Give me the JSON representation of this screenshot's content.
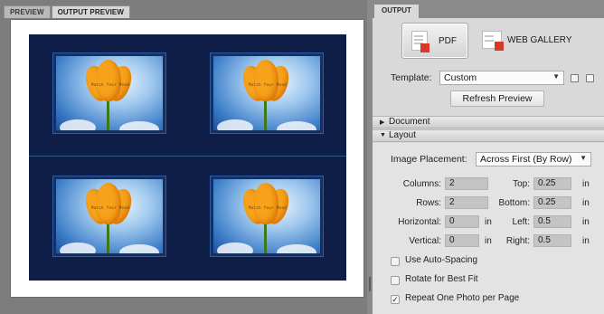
{
  "preview_tabs": [
    {
      "label": "PREVIEW",
      "active": false
    },
    {
      "label": "OUTPUT PREVIEW",
      "active": true
    }
  ],
  "preview": {
    "photo_caption": "Match Your Mood",
    "photo_count": 4
  },
  "output": {
    "tab_label": "OUTPUT",
    "pdf_button_label": "PDF",
    "web_gallery_label": "WEB GALLERY",
    "template_label": "Template:",
    "template_value": "Custom",
    "refresh_label": "Refresh Preview"
  },
  "sections": {
    "document": "Document",
    "layout": "Layout"
  },
  "layout": {
    "image_placement_label": "Image Placement:",
    "image_placement_value": "Across First (By Row)",
    "columns_label": "Columns:",
    "columns_value": "2",
    "rows_label": "Rows:",
    "rows_value": "2",
    "horizontal_label": "Horizontal:",
    "horizontal_value": "0",
    "vertical_label": "Vertical:",
    "vertical_value": "0",
    "top_label": "Top:",
    "top_value": "0.25",
    "bottom_label": "Bottom:",
    "bottom_value": "0.25",
    "left_label": "Left:",
    "left_value": "0.5",
    "right_label": "Right:",
    "right_value": "0.5",
    "unit": "in"
  },
  "options": [
    {
      "label": "Use Auto-Spacing",
      "checked": false
    },
    {
      "label": "Rotate for Best Fit",
      "checked": false
    },
    {
      "label": "Repeat One Photo per Page",
      "checked": true
    }
  ],
  "colors": {
    "sheet_background": "#0e1e46",
    "tulip": "#f6a21a"
  }
}
